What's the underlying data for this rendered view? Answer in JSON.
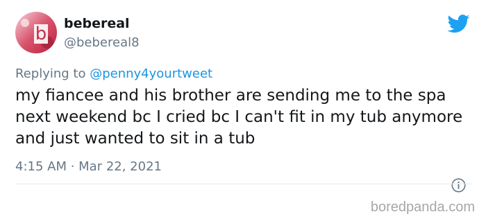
{
  "tweet": {
    "display_name": "bebereal",
    "handle": "@bebereal8",
    "reply_prefix": "Replying to ",
    "reply_to": "@penny4yourtweet",
    "text": "my fiancee and his brother are sending me to the spa next weekend bc I cried bc I can't fit in my tub anymore and just wanted to sit in a tub",
    "timestamp": "4:15 AM · Mar 22, 2021"
  },
  "avatar": {
    "letter": "b"
  },
  "icons": {
    "brand": "twitter-bird-icon",
    "info": "info-icon"
  },
  "watermark": "boredpanda.com",
  "colors": {
    "accent": "#1da1f2",
    "link": "#1b95e0",
    "muted": "#657786",
    "text": "#14171a"
  }
}
